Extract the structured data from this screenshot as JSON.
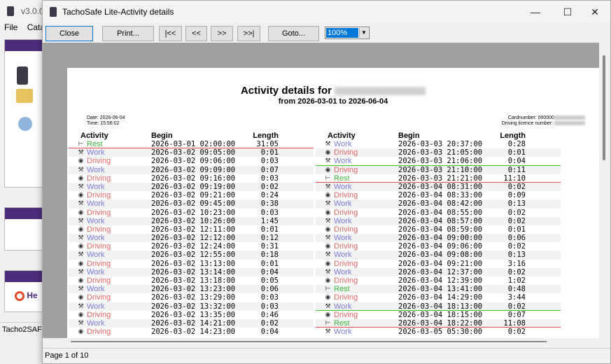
{
  "bg": {
    "version": "v3.0.0",
    "menu": [
      "File",
      "Cata"
    ],
    "help": "He",
    "status": "Tacho2SAF"
  },
  "dialog": {
    "title": "TachoSafe Lite-Activity details"
  },
  "toolbar": {
    "close": "Close",
    "print": "Print...",
    "first": "|<<",
    "prev": "<<",
    "next": ">>",
    "last": ">>|",
    "goto": "Goto...",
    "zoom": "100%"
  },
  "doc": {
    "title": "Activity details for",
    "subtitle": "from 2026-03-01 to 2026-06-04",
    "date": "Date: 2026-06-04",
    "time": "Time: 15:56:02",
    "cardnumber": "Cardnumber: 000000",
    "licence": "Driving licence number:",
    "headers": {
      "activity": "Activity",
      "begin": "Begin",
      "length": "Length"
    }
  },
  "colors": {
    "Rest": "#3cb83c",
    "Work": "#7b7bd9",
    "Driving": "#e06464"
  },
  "left_rows": [
    {
      "activity": "Rest",
      "begin": "2026-03-01 02:00:00",
      "length": "31:05",
      "line": "red"
    },
    {
      "activity": "Work",
      "begin": "2026-03-02 09:05:00",
      "length": "0:01"
    },
    {
      "activity": "Driving",
      "begin": "2026-03-02 09:06:00",
      "length": "0:03"
    },
    {
      "activity": "Work",
      "begin": "2026-03-02 09:09:00",
      "length": "0:07"
    },
    {
      "activity": "Driving",
      "begin": "2026-03-02 09:16:00",
      "length": "0:03"
    },
    {
      "activity": "Work",
      "begin": "2026-03-02 09:19:00",
      "length": "0:02"
    },
    {
      "activity": "Driving",
      "begin": "2026-03-02 09:21:00",
      "length": "0:24"
    },
    {
      "activity": "Work",
      "begin": "2026-03-02 09:45:00",
      "length": "0:38"
    },
    {
      "activity": "Driving",
      "begin": "2026-03-02 10:23:00",
      "length": "0:03"
    },
    {
      "activity": "Work",
      "begin": "2026-03-02 10:26:00",
      "length": "1:45"
    },
    {
      "activity": "Driving",
      "begin": "2026-03-02 12:11:00",
      "length": "0:01"
    },
    {
      "activity": "Work",
      "begin": "2026-03-02 12:12:00",
      "length": "0:12"
    },
    {
      "activity": "Driving",
      "begin": "2026-03-02 12:24:00",
      "length": "0:31"
    },
    {
      "activity": "Work",
      "begin": "2026-03-02 12:55:00",
      "length": "0:18"
    },
    {
      "activity": "Driving",
      "begin": "2026-03-02 13:13:00",
      "length": "0:01"
    },
    {
      "activity": "Work",
      "begin": "2026-03-02 13:14:00",
      "length": "0:04"
    },
    {
      "activity": "Driving",
      "begin": "2026-03-02 13:18:00",
      "length": "0:05"
    },
    {
      "activity": "Work",
      "begin": "2026-03-02 13:23:00",
      "length": "0:06"
    },
    {
      "activity": "Driving",
      "begin": "2026-03-02 13:29:00",
      "length": "0:03"
    },
    {
      "activity": "Work",
      "begin": "2026-03-02 13:32:00",
      "length": "0:03"
    },
    {
      "activity": "Driving",
      "begin": "2026-03-02 13:35:00",
      "length": "0:46"
    },
    {
      "activity": "Work",
      "begin": "2026-03-02 14:21:00",
      "length": "0:02"
    },
    {
      "activity": "Driving",
      "begin": "2026-03-02 14:23:00",
      "length": "0:04"
    }
  ],
  "right_rows": [
    {
      "activity": "Work",
      "begin": "2026-03-03 20:37:00",
      "length": "0:28"
    },
    {
      "activity": "Driving",
      "begin": "2026-03-03 21:05:00",
      "length": "0:01"
    },
    {
      "activity": "Work",
      "begin": "2026-03-03 21:06:00",
      "length": "0:04",
      "line": "green"
    },
    {
      "activity": "Driving",
      "begin": "2026-03-03 21:10:00",
      "length": "0:11"
    },
    {
      "activity": "Rest",
      "begin": "2026-03-03 21:21:00",
      "length": "11:10",
      "line": "red"
    },
    {
      "activity": "Work",
      "begin": "2026-03-04 08:31:00",
      "length": "0:02"
    },
    {
      "activity": "Driving",
      "begin": "2026-03-04 08:33:00",
      "length": "0:09"
    },
    {
      "activity": "Work",
      "begin": "2026-03-04 08:42:00",
      "length": "0:13"
    },
    {
      "activity": "Driving",
      "begin": "2026-03-04 08:55:00",
      "length": "0:02"
    },
    {
      "activity": "Work",
      "begin": "2026-03-04 08:57:00",
      "length": "0:02"
    },
    {
      "activity": "Driving",
      "begin": "2026-03-04 08:59:00",
      "length": "0:01"
    },
    {
      "activity": "Work",
      "begin": "2026-03-04 09:00:00",
      "length": "0:06"
    },
    {
      "activity": "Driving",
      "begin": "2026-03-04 09:06:00",
      "length": "0:02"
    },
    {
      "activity": "Work",
      "begin": "2026-03-04 09:08:00",
      "length": "0:13"
    },
    {
      "activity": "Driving",
      "begin": "2026-03-04 09:21:00",
      "length": "3:16"
    },
    {
      "activity": "Work",
      "begin": "2026-03-04 12:37:00",
      "length": "0:02"
    },
    {
      "activity": "Driving",
      "begin": "2026-03-04 12:39:00",
      "length": "1:02"
    },
    {
      "activity": "Rest",
      "begin": "2026-03-04 13:41:00",
      "length": "0:48"
    },
    {
      "activity": "Driving",
      "begin": "2026-03-04 14:29:00",
      "length": "3:44"
    },
    {
      "activity": "Work",
      "begin": "2026-03-04 18:13:00",
      "length": "0:02",
      "line": "green"
    },
    {
      "activity": "Driving",
      "begin": "2026-03-04 18:15:00",
      "length": "0:07"
    },
    {
      "activity": "Rest",
      "begin": "2026-03-04 18:22:00",
      "length": "11:08",
      "line": "red"
    },
    {
      "activity": "Work",
      "begin": "2026-03-05 05:30:00",
      "length": "0:02"
    }
  ],
  "status": {
    "page": "Page 1 of 10"
  }
}
